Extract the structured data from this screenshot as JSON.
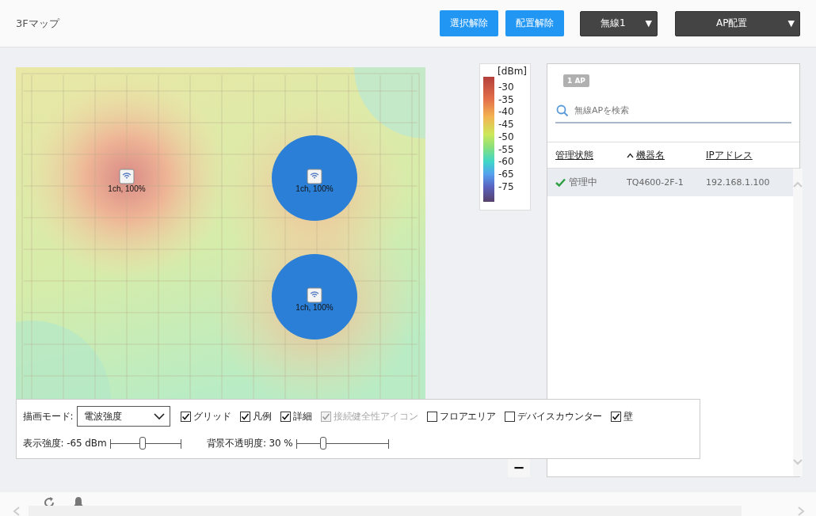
{
  "header": {
    "title": "3Fマップ",
    "buttons": [
      "選択解除",
      "配置解除"
    ],
    "dropdowns": [
      {
        "label": "無線1",
        "arrow": "▼"
      },
      {
        "label": "AP配置",
        "arrow": "▼"
      }
    ]
  },
  "map": {
    "access_points": [
      {
        "label": "1ch, 100%",
        "selected": false
      },
      {
        "label": "1ch, 100%",
        "selected": true
      },
      {
        "label": "1ch, 100%",
        "selected": true
      }
    ]
  },
  "legend": {
    "unit": "[dBm]",
    "ticks": [
      "-30",
      "-35",
      "-40",
      "-45",
      "-50",
      "-55",
      "-60",
      "-65",
      "-75"
    ]
  },
  "zoom_out": {
    "label": "−"
  },
  "controls": {
    "mode_label": "描画モード:",
    "mode_value": "電波強度",
    "checkboxes": [
      {
        "label": "グリッド",
        "checked": true,
        "disabled": false
      },
      {
        "label": "凡例",
        "checked": true,
        "disabled": false
      },
      {
        "label": "詳細",
        "checked": true,
        "disabled": false
      },
      {
        "label": "接続健全性アイコン",
        "checked": true,
        "disabled": true
      },
      {
        "label": "フロアエリア",
        "checked": false,
        "disabled": false
      },
      {
        "label": "デバイスカウンター",
        "checked": false,
        "disabled": false
      },
      {
        "label": "壁",
        "checked": true,
        "disabled": false
      }
    ],
    "sliders": [
      {
        "label": "表示強度: -65 dBm",
        "level": 0.47
      },
      {
        "label": "背景不透明度: 30 %",
        "level": 0.3
      }
    ]
  },
  "ap_panel": {
    "count_badge": "1 AP",
    "search": {
      "placeholder": "無線APを検索"
    },
    "columns": [
      {
        "label": "管理状態",
        "sorted": false
      },
      {
        "label": "機器名",
        "sorted": true
      },
      {
        "label": "IPアドレス",
        "sorted": false
      }
    ],
    "rows": [
      {
        "status": "管理中",
        "name": "TQ4600-2F-1",
        "ip": "192.168.1.100",
        "selected": true
      }
    ]
  }
}
